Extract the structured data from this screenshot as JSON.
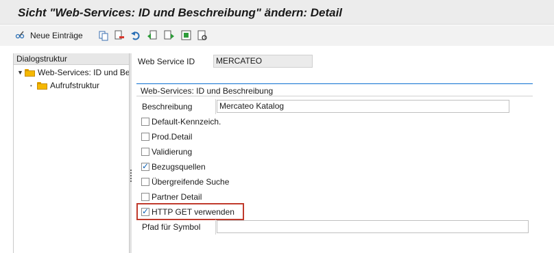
{
  "window": {
    "title": "Sicht \"Web-Services: ID und Beschreibung\" ändern: Detail"
  },
  "toolbar": {
    "new_entries_label": "Neue Einträge",
    "icons": [
      "glasses-pencil-icon",
      "copy-icon",
      "delete-icon",
      "undo-icon",
      "previous-entry-icon",
      "next-entry-icon",
      "select-all-icon",
      "find-icon"
    ]
  },
  "dialog_structure": {
    "header": "Dialogstruktur",
    "items": [
      {
        "label": "Web-Services: ID und Be",
        "expanded": true
      },
      {
        "label": "Aufrufstruktur"
      }
    ]
  },
  "form": {
    "web_service_id_label": "Web Service ID",
    "web_service_id_value": "MERCATEO",
    "group_title": "Web-Services: ID und Beschreibung",
    "description_label": "Beschreibung",
    "description_value": "Mercateo Katalog",
    "checkboxes": [
      {
        "label": "Default-Kennzeich.",
        "checked": false
      },
      {
        "label": "Prod.Detail",
        "checked": false
      },
      {
        "label": "Validierung",
        "checked": false
      },
      {
        "label": "Bezugsquellen",
        "checked": true
      },
      {
        "label": "Übergreifende Suche",
        "checked": false
      },
      {
        "label": "Partner Detail",
        "checked": false
      },
      {
        "label": "HTTP GET verwenden",
        "checked": true
      }
    ],
    "symbol_path_label": "Pfad für Symbol",
    "symbol_path_value": ""
  },
  "colors": {
    "highlight": "#c0392b",
    "accent": "#0a6ed1",
    "folder": "#f5b800"
  }
}
